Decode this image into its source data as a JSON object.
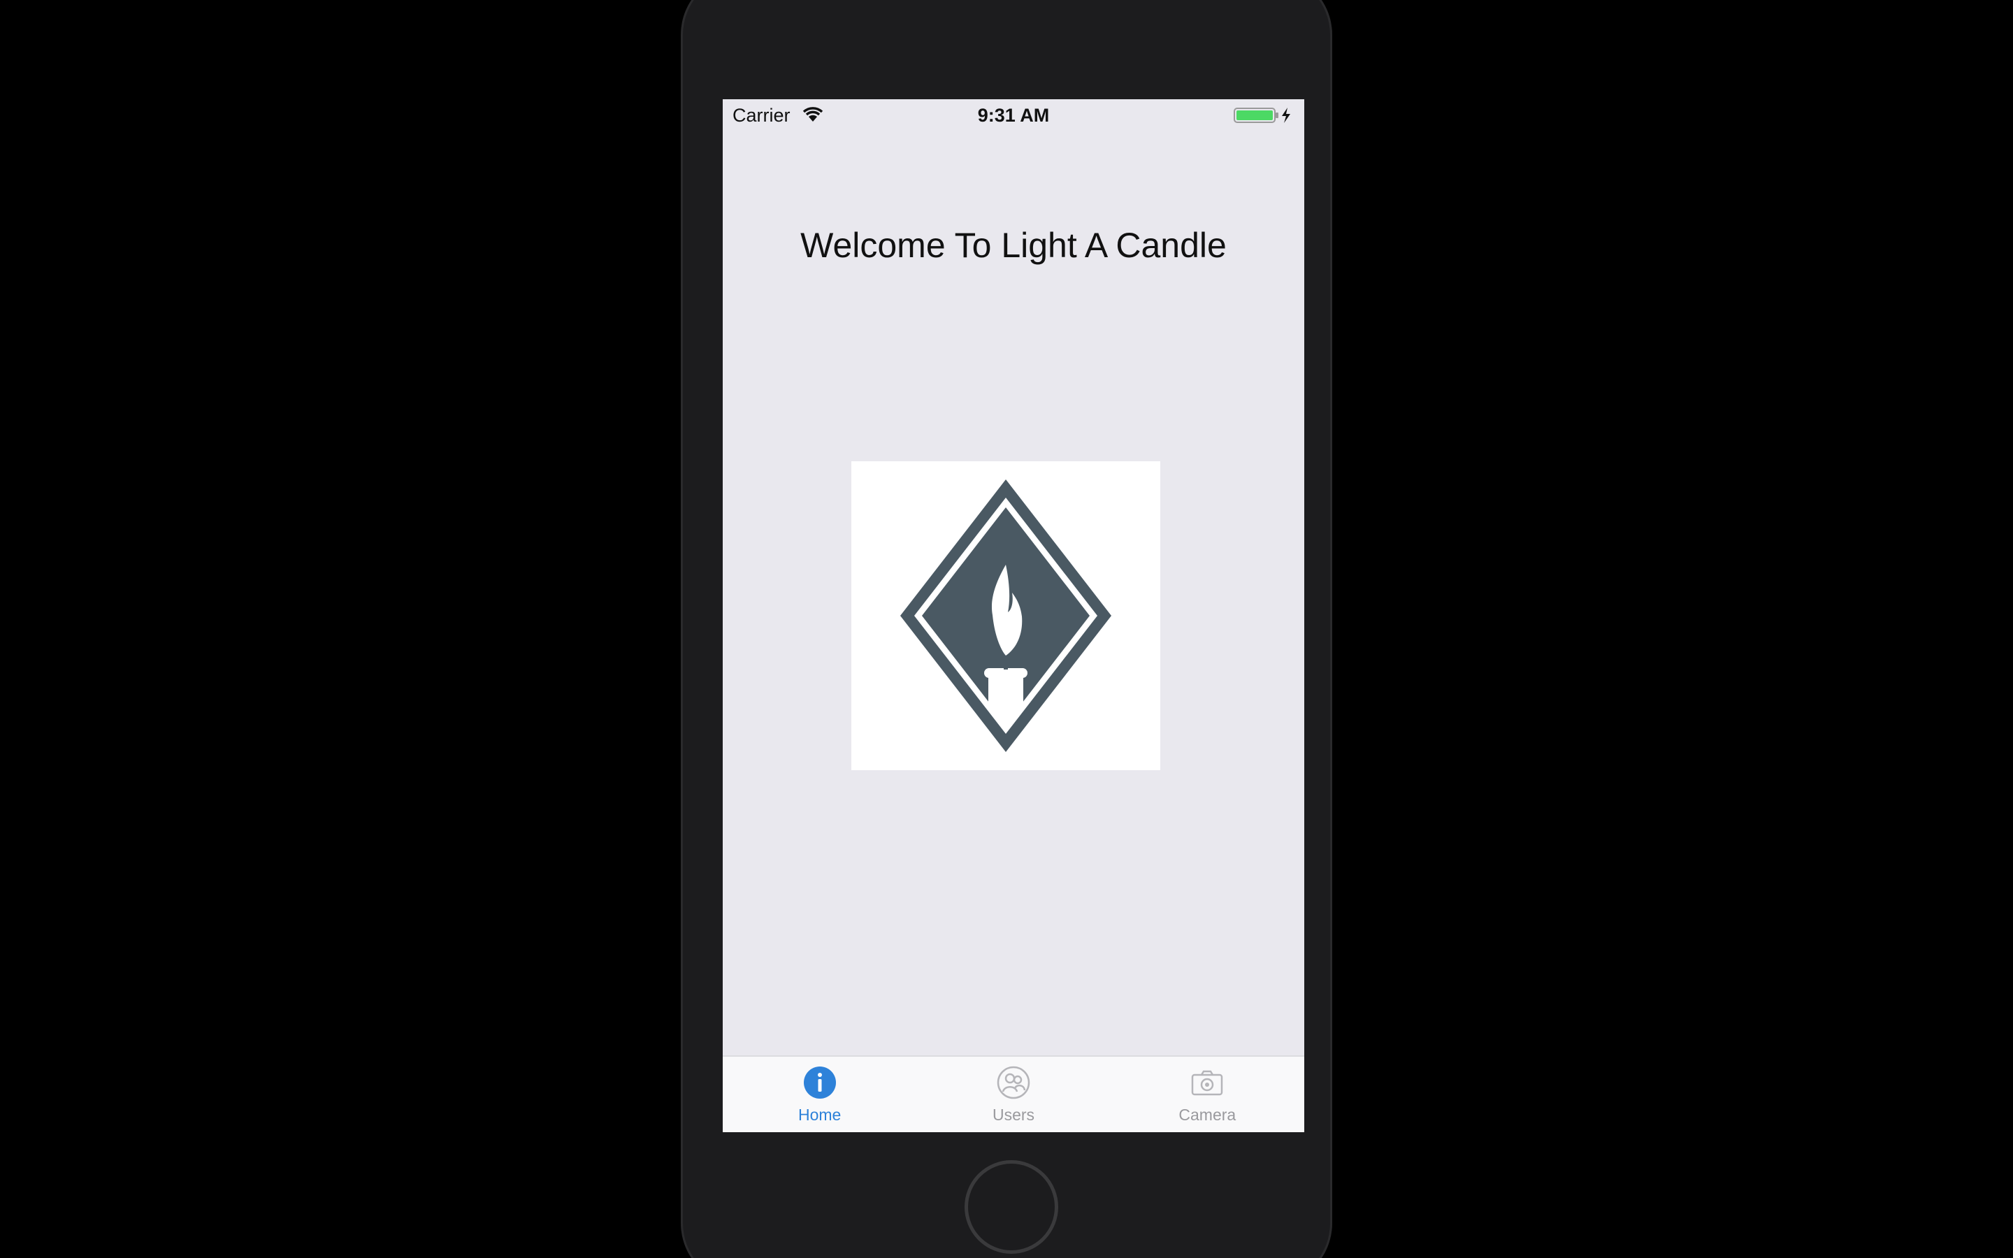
{
  "status_bar": {
    "carrier": "Carrier",
    "time": "9:31 AM",
    "battery_icon": "battery-charging-icon",
    "wifi_icon": "wifi-icon"
  },
  "main": {
    "welcome_title": "Welcome To Light A Candle",
    "logo_icon": "candle-diamond-logo"
  },
  "tab_bar": {
    "tabs": [
      {
        "label": "Home",
        "icon": "info-icon",
        "active": true
      },
      {
        "label": "Users",
        "icon": "users-icon",
        "active": false
      },
      {
        "label": "Camera",
        "icon": "camera-icon",
        "active": false
      }
    ]
  },
  "colors": {
    "accent": "#2e82d9",
    "logo": "#4a5963",
    "screen_background": "#e9e8ee",
    "battery": "#4cd964"
  }
}
